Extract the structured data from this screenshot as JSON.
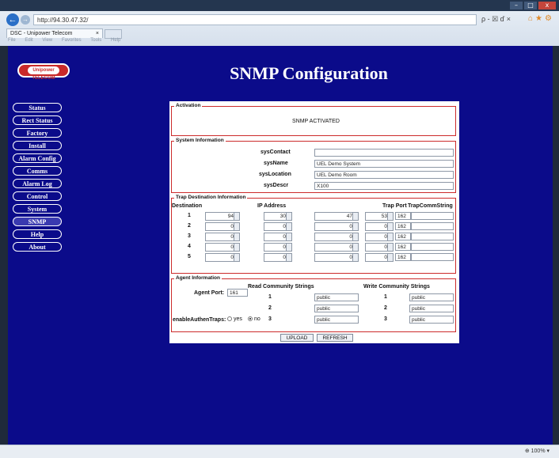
{
  "browser": {
    "url": "http://94.30.47.32/",
    "address_controls": "ρ - ☒ ď ×",
    "tab_label": "DSC - Unipower Telecom",
    "tab_close": "×",
    "menu": [
      "File",
      "Edit",
      "View",
      "Favorites",
      "Tools",
      "Help"
    ],
    "window_buttons": [
      "–",
      "□",
      "x"
    ],
    "zoom_label": "⊕ 100% ▾"
  },
  "logo": {
    "text": "Unipower TELECOM"
  },
  "page": {
    "title": "SNMP Configuration"
  },
  "sidebar": {
    "items": [
      {
        "label": "Status"
      },
      {
        "label": "Rect Status"
      },
      {
        "label": "Factory"
      },
      {
        "label": "Install"
      },
      {
        "label": "Alarm Config"
      },
      {
        "label": "Comms"
      },
      {
        "label": "Alarm Log"
      },
      {
        "label": "Control"
      },
      {
        "label": "System"
      },
      {
        "label": "SNMP"
      },
      {
        "label": "Help"
      },
      {
        "label": "About"
      }
    ]
  },
  "activation": {
    "legend": "Activation",
    "status": "SNMP ACTIVATED"
  },
  "system_info": {
    "legend": "System Information",
    "fields": [
      {
        "label": "sysContact",
        "value": ""
      },
      {
        "label": "sysName",
        "value": "UEL Demo System"
      },
      {
        "label": "sysLocation",
        "value": "UEL Demo Room"
      },
      {
        "label": "sysDescr",
        "value": "X100"
      }
    ]
  },
  "trap": {
    "legend": "Trap Destination Information",
    "headers": {
      "destination": "Destination",
      "ip": "IP Address",
      "port": "Trap Port",
      "community": "TrapCommString"
    },
    "rows": [
      {
        "num": "1",
        "ip": [
          "94",
          "30",
          "47",
          "53"
        ],
        "port": "162",
        "community": ""
      },
      {
        "num": "2",
        "ip": [
          "0",
          "0",
          "0",
          "0"
        ],
        "port": "162",
        "community": ""
      },
      {
        "num": "3",
        "ip": [
          "0",
          "0",
          "0",
          "0"
        ],
        "port": "162",
        "community": ""
      },
      {
        "num": "4",
        "ip": [
          "0",
          "0",
          "0",
          "0"
        ],
        "port": "162",
        "community": ""
      },
      {
        "num": "5",
        "ip": [
          "0",
          "0",
          "0",
          "0"
        ],
        "port": "162",
        "community": ""
      }
    ]
  },
  "agent": {
    "legend": "Agent Information",
    "port_label": "Agent Port:",
    "port_value": "161",
    "read_header": "Read Community Strings",
    "write_header": "Write Community Strings",
    "read": [
      {
        "num": "1",
        "value": "public"
      },
      {
        "num": "2",
        "value": "public"
      },
      {
        "num": "3",
        "value": "public"
      }
    ],
    "write": [
      {
        "num": "1",
        "value": "public"
      },
      {
        "num": "2",
        "value": "public"
      },
      {
        "num": "3",
        "value": "public"
      }
    ],
    "auth_label": "enableAuthenTraps:",
    "yes_label": "yes",
    "no_label": "no"
  },
  "actions": {
    "upload": "UPLOAD",
    "refresh": "REFRESH"
  }
}
